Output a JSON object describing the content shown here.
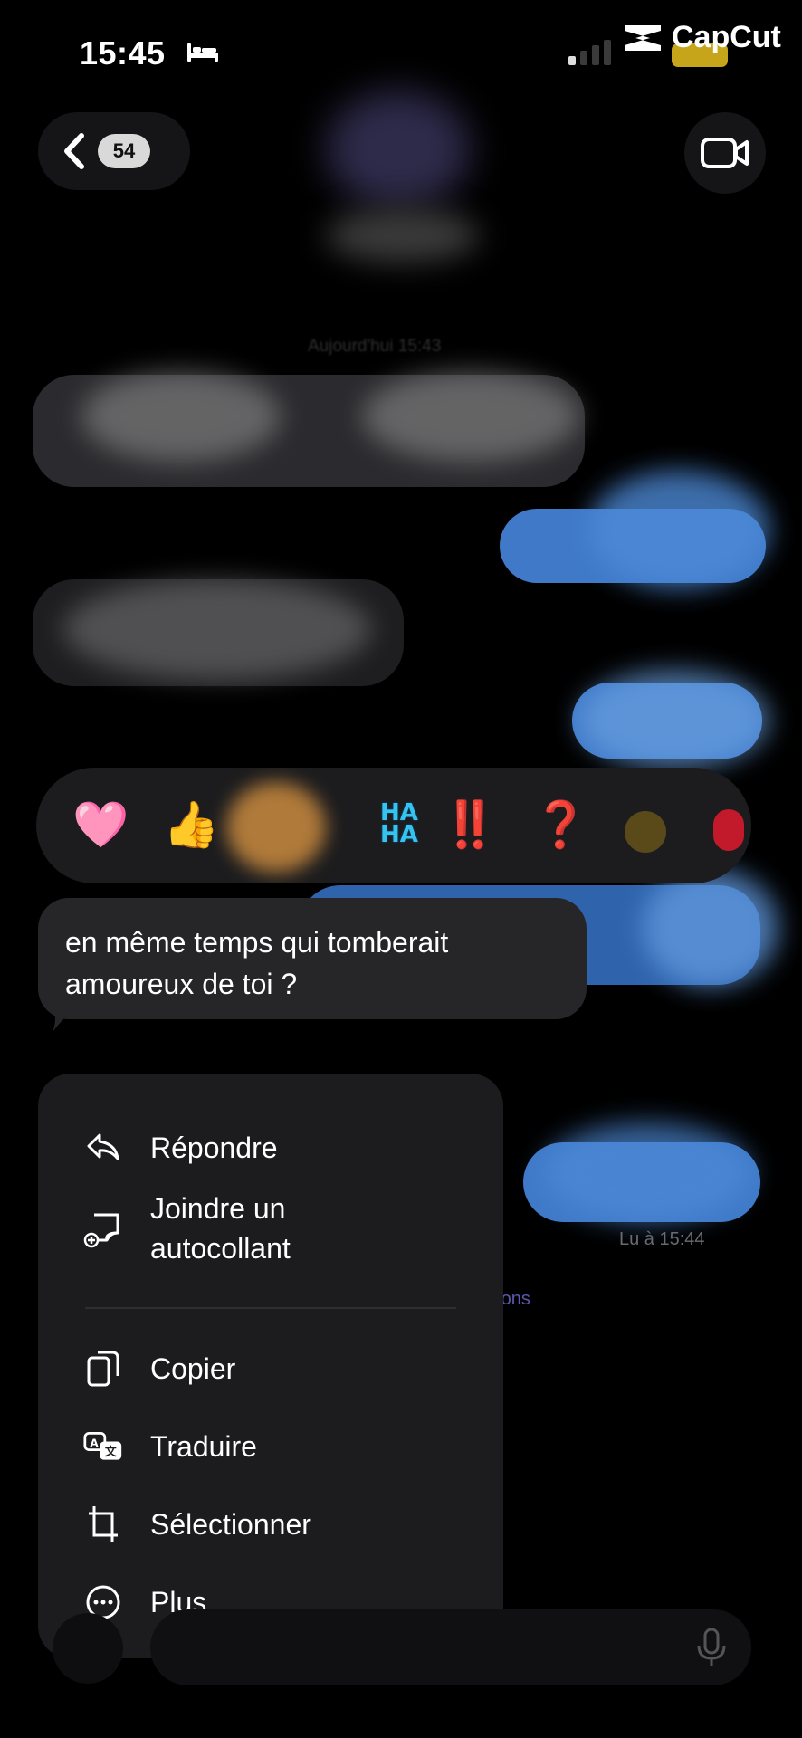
{
  "status_bar": {
    "time": "15:45",
    "battery": "31"
  },
  "watermark": {
    "app_name": "CapCut"
  },
  "header": {
    "unread_count": "54"
  },
  "conversation": {
    "date_label": "Aujourd'hui 15:43",
    "read_receipt": "Lu à 15:44",
    "notification_link": "ications"
  },
  "reactions": [
    {
      "name": "heart",
      "glyph": "🩷"
    },
    {
      "name": "thumbs-up",
      "glyph": "👍"
    },
    {
      "name": "haha",
      "line1": "HA",
      "line2": "HA"
    },
    {
      "name": "exclamation",
      "glyph": "‼️"
    },
    {
      "name": "question",
      "glyph": "❓"
    }
  ],
  "selected_message": {
    "line1": "en même temps qui tomberait",
    "line2": "amoureux de toi ?"
  },
  "menu": {
    "reply": "Répondre",
    "sticker_line1": "Joindre un",
    "sticker_line2": "autocollant",
    "copy": "Copier",
    "translate": "Traduire",
    "select": "Sélectionner",
    "more": "Plus..."
  },
  "colors": {
    "background": "#000000",
    "bubble_grey": "#2b2b2f",
    "bubble_blue": "#3f79c8",
    "menu_bg": "#1c1c1e",
    "battery": "#c6a51a"
  }
}
